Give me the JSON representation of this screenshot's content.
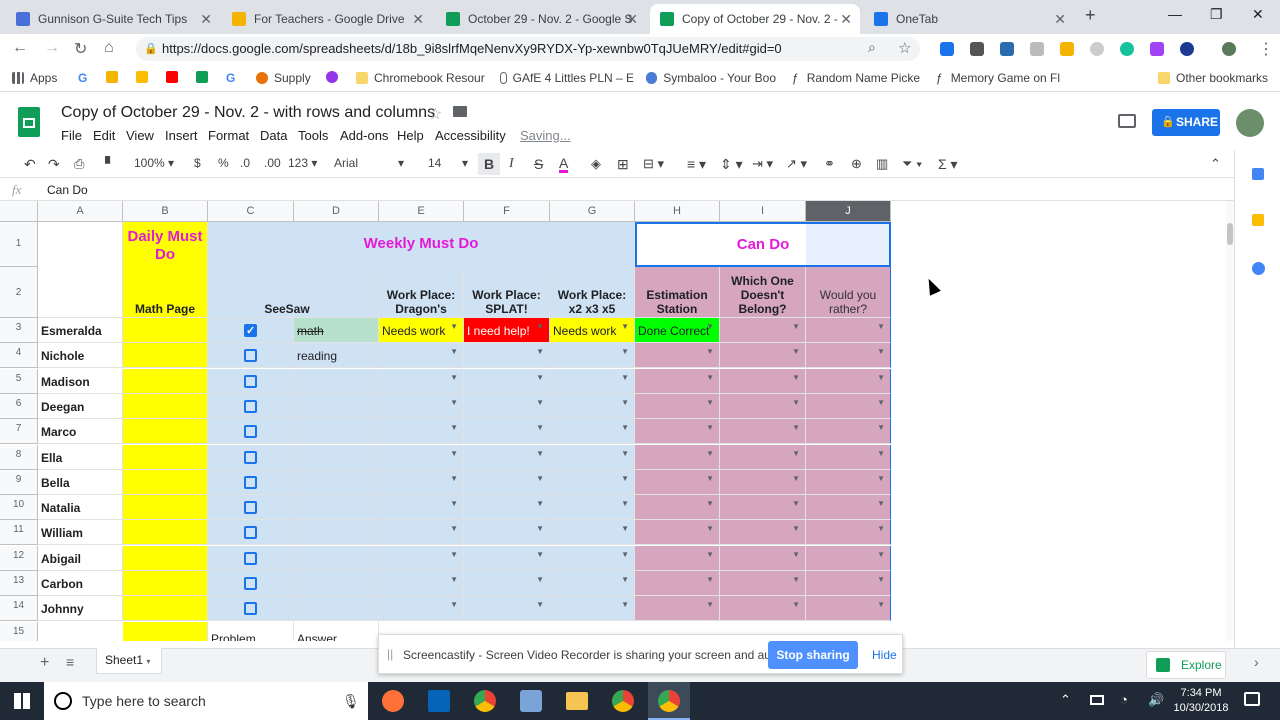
{
  "tabs": [
    {
      "label": "Gunnison G-Suite Tech Tips",
      "color": "#4a6fd8"
    },
    {
      "label": "For Teachers - Google Drive",
      "color": "#f4b400"
    },
    {
      "label": "October 29 - Nov. 2 - Google S",
      "color": "#0f9d58"
    },
    {
      "label": "Copy of October 29 - Nov. 2 -",
      "color": "#0f9d58"
    },
    {
      "label": "OneTab",
      "color": "#1a73e8"
    }
  ],
  "url": "https://docs.google.com/spreadsheets/d/18b_9i8slrfMqeNenvXy9RYDX-Yp-xewnbw0TqJUeMRY/edit#gid=0",
  "bookmarks": [
    "Apps",
    "Supply",
    "Chromebook Resour",
    "GAfE 4 Littles PLN – E",
    "Symbaloo - Your Boo",
    "Random Name Picke",
    "Memory Game on Fl",
    "Other bookmarks"
  ],
  "doc": {
    "title": "Copy of October 29 - Nov. 2 - with rows and columns",
    "saving": "Saving...",
    "share": "SHARE"
  },
  "menu": [
    "File",
    "Edit",
    "View",
    "Insert",
    "Format",
    "Data",
    "Tools",
    "Add-ons",
    "Help",
    "Accessibility"
  ],
  "toolbar": {
    "zoom": "100%",
    "currency": "$",
    "percent": "%",
    "dec0": ".0",
    "dec00": ".00",
    "fmt": "123",
    "font": "Arial",
    "size": "14"
  },
  "formula": {
    "fx": "fx",
    "value": "Can Do"
  },
  "columns": [
    "A",
    "B",
    "C",
    "D",
    "E",
    "F",
    "G",
    "H",
    "I",
    "J"
  ],
  "rows": [
    "1",
    "2",
    "3",
    "4",
    "5",
    "6",
    "7",
    "8",
    "9",
    "10",
    "11",
    "12",
    "13",
    "14",
    "15"
  ],
  "headers": {
    "daily": "Daily Must Do",
    "weekly": "Weekly Must Do",
    "cando": "Can Do",
    "math_page": "Math Page",
    "seesaw": "SeeSaw",
    "e": "Work Place: Dragon's Gold",
    "f": "Work Place: SPLAT!",
    "g": "Work Place: x2 x3 x5",
    "h": "Estimation Station",
    "i": "Which One Doesn't Belong?",
    "j": "Would you rather?"
  },
  "students": [
    "Esmeralda",
    "Nichole",
    "Madison",
    "Deegan",
    "Marco",
    "Ella",
    "Bella",
    "Natalia",
    "William",
    "Abigail",
    "Carbon",
    "Johnny"
  ],
  "row3": {
    "d": "math",
    "e": "Needs work",
    "f": "I need help!",
    "g": "Needs work",
    "h": "Done Correct"
  },
  "row4": {
    "d": "reading"
  },
  "row15": {
    "c": "Problem",
    "d": "Answer"
  },
  "sheet_tab": "Sheet1",
  "explore": "Explore",
  "castify": {
    "message": "Screencastify - Screen Video Recorder is sharing your screen and audio.",
    "stop": "Stop sharing",
    "hide": "Hide"
  },
  "taskbar": {
    "search": "Type here to search",
    "time": "7:34 PM",
    "date": "10/30/2018"
  },
  "colors": {
    "yellow": "#ffff00",
    "blue": "#cfe2f3",
    "purple": "#d5a6bd",
    "magenta": "#e41adb",
    "green": "#00ff00",
    "red": "#ff0000"
  }
}
